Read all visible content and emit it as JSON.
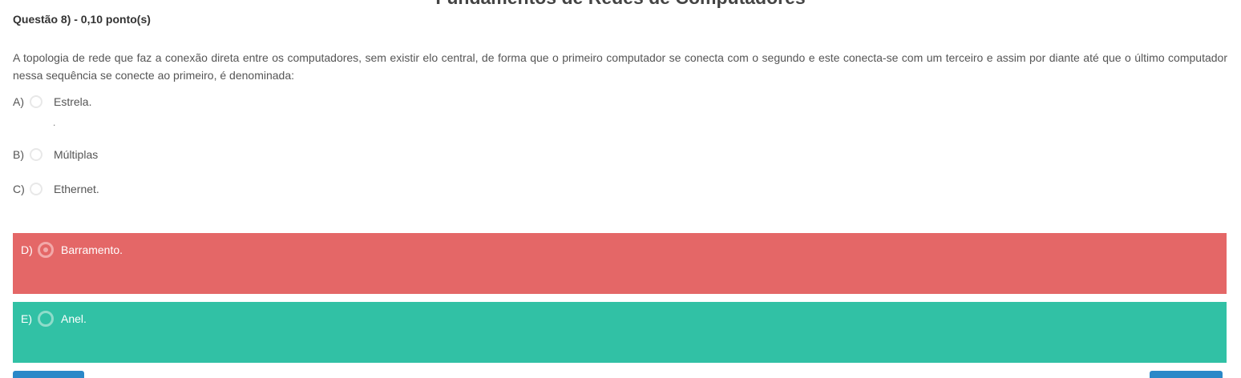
{
  "course": {
    "title": "Fundamentos de Redes de Computadores"
  },
  "question": {
    "heading": "Questão 8) - 0,10 ponto(s)",
    "text": "A topologia de rede que faz a conexão direta entre os computadores, sem existir elo central, de forma que o primeiro computador se conecta com o segundo e este conecta-se com um terceiro e assim por diante até que o último computador nessa sequência se conecte ao primeiro, é denominada:"
  },
  "options": [
    {
      "letter": "A)",
      "label": "Estrela.",
      "sub": "."
    },
    {
      "letter": "B)",
      "label": "Múltiplas"
    },
    {
      "letter": "C)",
      "label": "Ethernet."
    },
    {
      "letter": "D)",
      "label": "Barramento.",
      "status": "selected-wrong",
      "color": "#e46767"
    },
    {
      "letter": "E)",
      "label": "Anel.",
      "status": "correct",
      "color": "#31c1a5"
    }
  ],
  "navigation": {
    "button_color": "#2a88c8"
  }
}
